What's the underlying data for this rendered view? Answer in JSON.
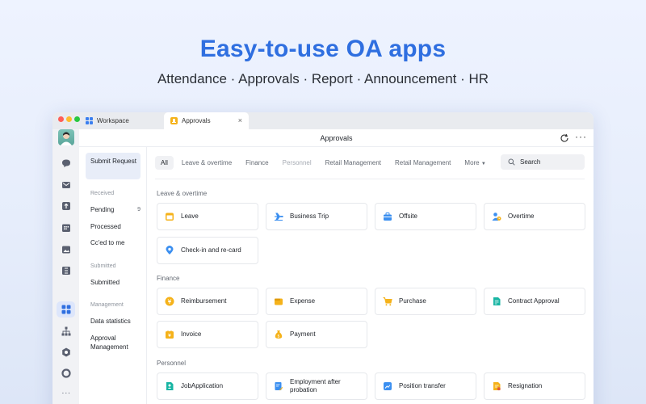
{
  "hero": {
    "title": "Easy-to-use OA apps",
    "subtitle": "Attendance · Approvals · Report · Announcement · HR"
  },
  "window": {
    "tabs": [
      {
        "label": "Workspace",
        "icon": "grid-icon"
      },
      {
        "label": "Approvals",
        "icon": "approval-icon",
        "close": "×"
      }
    ],
    "topbar": {
      "title": "Approvals",
      "more": "···"
    }
  },
  "rail": {
    "icons": [
      "chat-icon",
      "mail-icon",
      "upload-icon",
      "calendar-icon",
      "image-icon",
      "table-icon",
      "apps-icon",
      "org-chart-icon",
      "settings-icon",
      "circle-icon",
      "more-icon"
    ],
    "more_label": "···"
  },
  "subnav": {
    "submit_request": "Submit Request",
    "received_label": "Received",
    "pending": "Pending",
    "pending_count": "9",
    "processed": "Processed",
    "cced": "Cc'ed to me",
    "submitted_label": "Submitted",
    "submitted": "Submitted",
    "management_label": "Management",
    "data_statistics": "Data statistics",
    "approval_management": "Approval Management"
  },
  "filters": [
    "All",
    "Leave & overtime",
    "Finance",
    "Personnel",
    "Retail Management",
    "Retail Management",
    "More"
  ],
  "search": {
    "placeholder": "Search"
  },
  "sections": {
    "leave": {
      "title": "Leave & overtime",
      "cards": [
        "Leave",
        "Business Trip",
        "Offsite",
        "Overtime",
        "Check-in and re-card"
      ]
    },
    "finance": {
      "title": "Finance",
      "cards": [
        "Reimbursement",
        "Expense",
        "Purchase",
        "Contract Approval",
        "Invoice",
        "Payment"
      ]
    },
    "personnel": {
      "title": "Personnel",
      "cards": [
        "JobApplication",
        "Employment after probation",
        "Position transfer",
        "Resignation"
      ]
    }
  },
  "colors": {
    "accent": "#2f6fe0",
    "amber": "#f5b21a",
    "blue": "#3b8ff0",
    "teal": "#18b5a3"
  }
}
